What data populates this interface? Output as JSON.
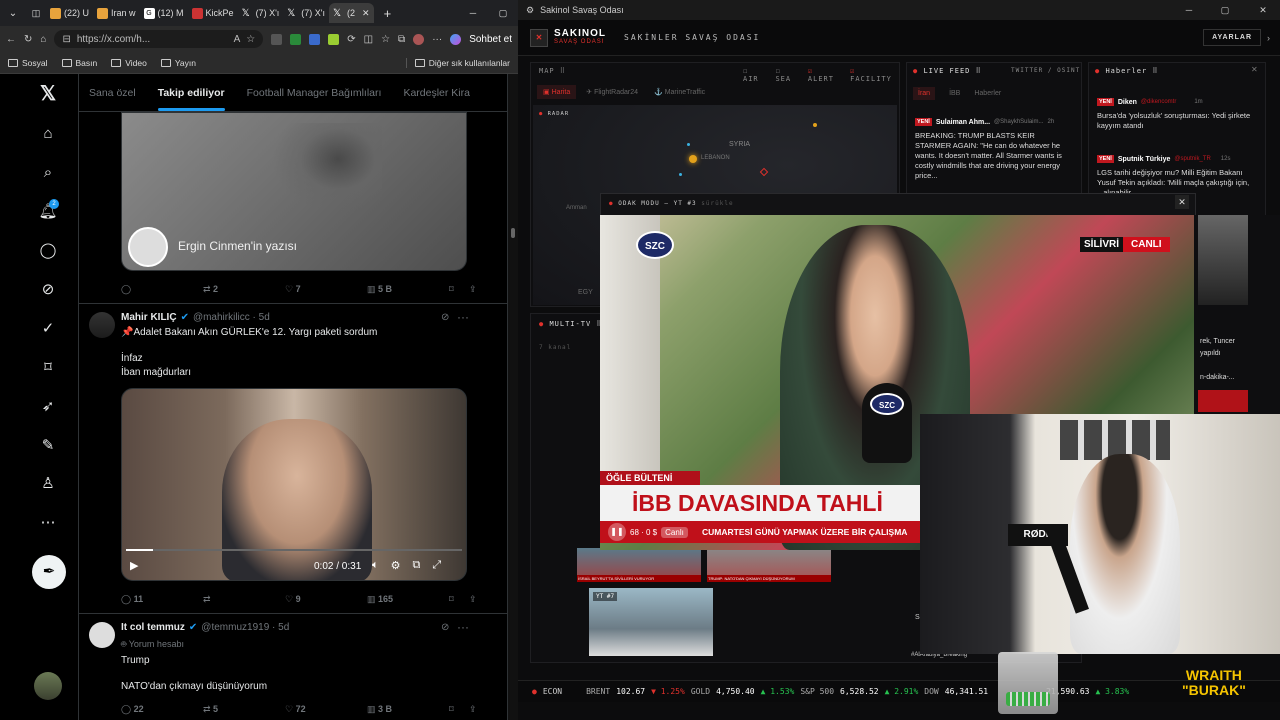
{
  "browser": {
    "tabs": [
      {
        "label": "(22) U",
        "color": "#e8a33c"
      },
      {
        "label": "Iran w",
        "color": "#e8a33c"
      },
      {
        "label": "(12) M",
        "color": "#ffffff"
      },
      {
        "label": "KickPe",
        "color": "#c33"
      },
      {
        "label": "(7) X'ı",
        "color": "#000"
      },
      {
        "label": "(7) X'ı",
        "color": "#000"
      },
      {
        "label": "(2",
        "color": "#000"
      }
    ],
    "url": "https://x.com/h...",
    "copilot_label": "Sohbet et",
    "bookmarks": [
      "Sosyal",
      "Basın",
      "Video",
      "Yayın"
    ],
    "other_bookmarks": "Diğer sık kullanılanlar"
  },
  "x": {
    "tabs": [
      "Sana özel",
      "Takip ediliyor",
      "Football Manager Bağımlıları",
      "Kardeşler Kira"
    ],
    "notif_count": "2",
    "article_label": "Ergin Cinmen'in yazısı",
    "tweet0_stats": {
      "replies": "",
      "reposts": "2",
      "likes": "7",
      "views": "5 B"
    },
    "tweet1": {
      "name": "Mahir KILIÇ",
      "handle": "@mahirkilicc · 5d",
      "line1": "📌Adalet Bakanı Akın GÜRLEK'e 12. Yargı paketi sordum",
      "line2": "İnfaz",
      "line3": "İban mağdurları",
      "video_time": "0:02 / 0:31",
      "stats": {
        "replies": "11",
        "reposts": "",
        "likes": "9",
        "views": "165"
      }
    },
    "tweet2": {
      "name": "It col temmuz",
      "handle": "@temmuz1919 · 5d",
      "subline": "Yorum hesabı",
      "line1": "Trump",
      "line2": "NATO'dan çıkmayı düşünüyorum",
      "stats": {
        "replies": "22",
        "reposts": "5",
        "likes": "72",
        "views": "3 B"
      }
    }
  },
  "app": {
    "window_title": "Sakinol Savaş Odası",
    "brand": "SAKINOL",
    "brand_sub": "SAVAŞ ODASI",
    "header_title": "SAKİNLER SAVAŞ ODASI",
    "settings": "AYARLAR",
    "map_label": "MAP",
    "filters": [
      "AIR",
      "SEA",
      "ALERT",
      "FACILITY"
    ],
    "map_tabs": [
      "Harita",
      "FlightRadar24",
      "MarineTraffic"
    ],
    "radar": "RADAR",
    "map_labels": [
      "SYRIA",
      "LEBANON",
      "EGY",
      "Amman"
    ],
    "live_feed": "LIVE FEED",
    "live_feed_sub": "TWITTER / OSINT",
    "feed_tabs": [
      "İran",
      "İBB",
      "Haberler"
    ],
    "feed_item": {
      "name": "Sulaiman Ahm...",
      "handle": "@ShaykhSulaim...",
      "time": "2h",
      "text": "BREAKING: TRUMP BLASTS KEIR STARMER AGAIN: \"He can do whatever he wants. It doesn't matter. All Starmer wants is costly windmills that are driving your energy price..."
    },
    "news_header": "Haberler",
    "news": [
      {
        "source": "Diken",
        "handle": "@dikencomtr",
        "time": "1m",
        "text": "Bursa'da 'yolsuzluk' soruşturması: Yedi şirkete kayyım atandı"
      },
      {
        "source": "Sputnik Türkiye",
        "handle": "@sputnik_TR",
        "time": "12s",
        "text": "LGS tarihi değişiyor mu? Milli Eğitim Bakanı Yusuf Tekin açıkladı: 'Milli maçla çakıştığı için, ...alınabilir,"
      }
    ],
    "news_partial": [
      "rek, Tuncer",
      "yapıldı",
      "n-dakika-..."
    ],
    "multitv": "MULTI-TV",
    "multitv_sub": "7 kanal",
    "focus_title": "ODAK MODU — YT #3",
    "focus_sub": "sürükle",
    "video": {
      "channel_logo": "SZC",
      "location": "SİLİVRİ",
      "live": "CANLI",
      "segment": "ÖĞLE BÜLTENİ",
      "headline": "İBB DAVASINDA TAHLİ",
      "ticker": "CUMARTESİ GÜNÜ YAPMAK ÜZERE BİR ÇALIŞMA",
      "mic_logo": "SZC",
      "stats": "68 · 0 $",
      "canli_small": "Canlı"
    },
    "thumb_captions": [
      "İSRAİL BEYRUT'TA SİVİLLERİ VURUYOR",
      "TRUMP: NATO'DAN ÇIKMAYI DÜŞÜNÜYORUM"
    ],
    "yt7": "YT #7",
    "alarabiya": "#AlArabiya_Breaking",
    "s_label": "S",
    "ticker_label": "ECON",
    "tickers": [
      {
        "name": "BRENT",
        "value": "102.67",
        "change": "▼ 1.25%",
        "dir": "down"
      },
      {
        "name": "GOLD",
        "value": "4,750.40",
        "change": "▲ 1.53%",
        "dir": "up"
      },
      {
        "name": "S&P 500",
        "value": "6,528.52",
        "change": "▲ 2.91%",
        "dir": "up"
      },
      {
        "name": "DOW",
        "value": "46,341.51",
        "change": "",
        "dir": "up"
      },
      {
        "name": "",
        "value": "21,590.63",
        "change": "▲ 3.83%",
        "dir": "up"
      }
    ]
  },
  "overlay": {
    "mic_brand": "RØDE",
    "watermark_line1": "WRAITH",
    "watermark_line2": "\"BURAK\""
  }
}
